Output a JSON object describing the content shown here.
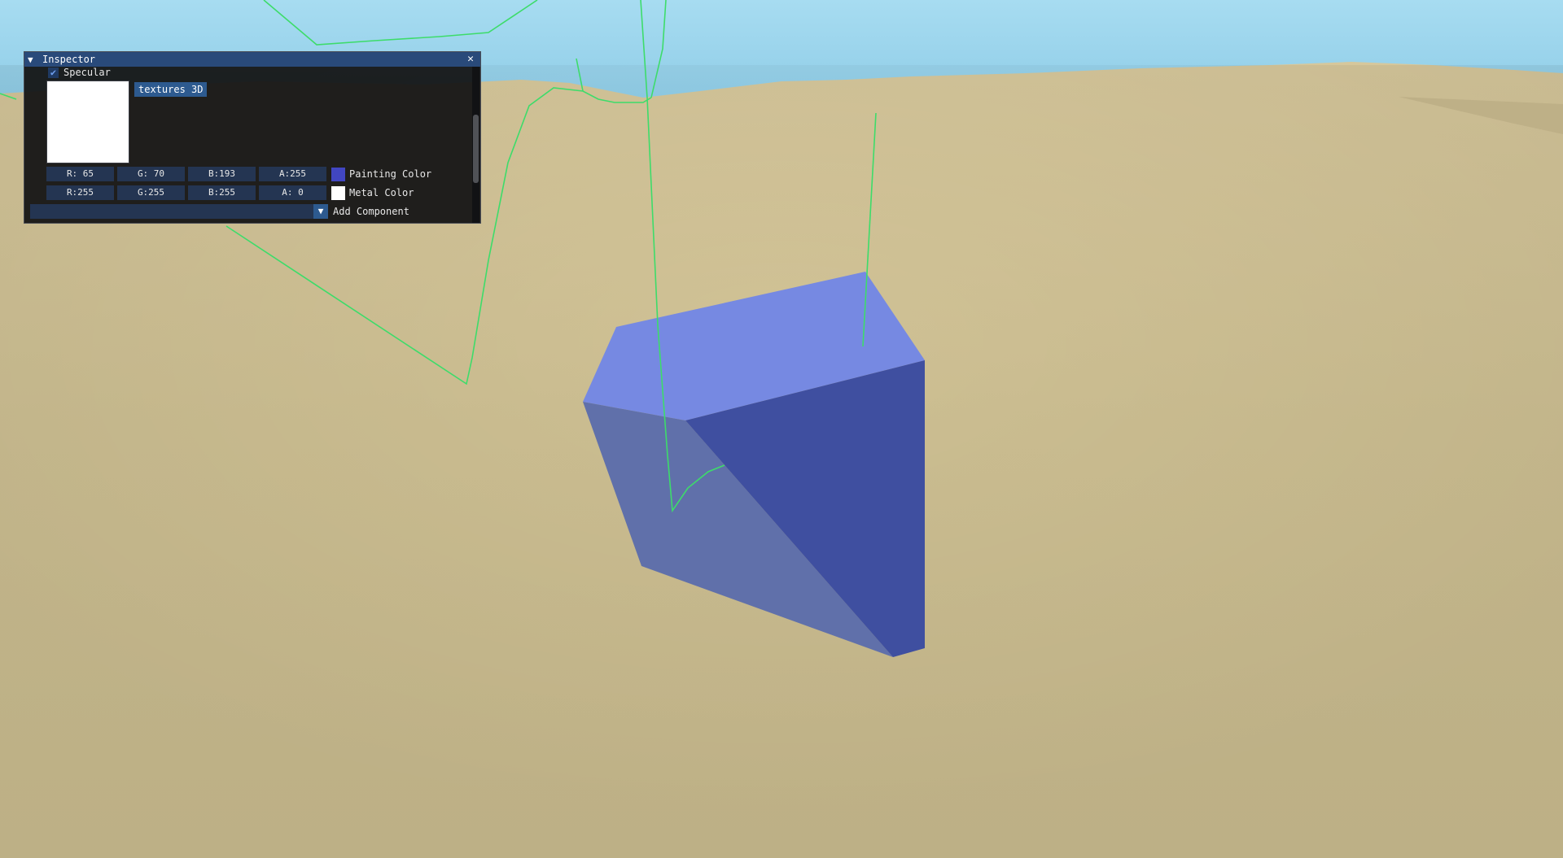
{
  "inspector": {
    "title": "Inspector",
    "collapse_icon": "triangle-down-icon",
    "close_icon": "close-icon",
    "specular": {
      "label": "Specular",
      "checked": true
    },
    "texture_preview_color": "#ffffff",
    "textures_button_label": "textures 3D",
    "painting_color": {
      "r": "R: 65",
      "g": "G: 70",
      "b": "B:193",
      "a": "A:255",
      "label": "Painting Color",
      "swatch": "#4146c1"
    },
    "metal_color": {
      "r": "R:255",
      "g": "G:255",
      "b": "B:255",
      "a": "A:  0",
      "label": "Metal Color",
      "swatch": "#ffffff"
    },
    "add_component": {
      "label": "Add Component",
      "value": ""
    },
    "scroll_position": 0.55
  },
  "scene": {
    "sky_color": "#8fd0ec",
    "sand_color": "#cdbf93",
    "object_color": "#4146c1",
    "gizmo_color": "#3ddc6a"
  }
}
